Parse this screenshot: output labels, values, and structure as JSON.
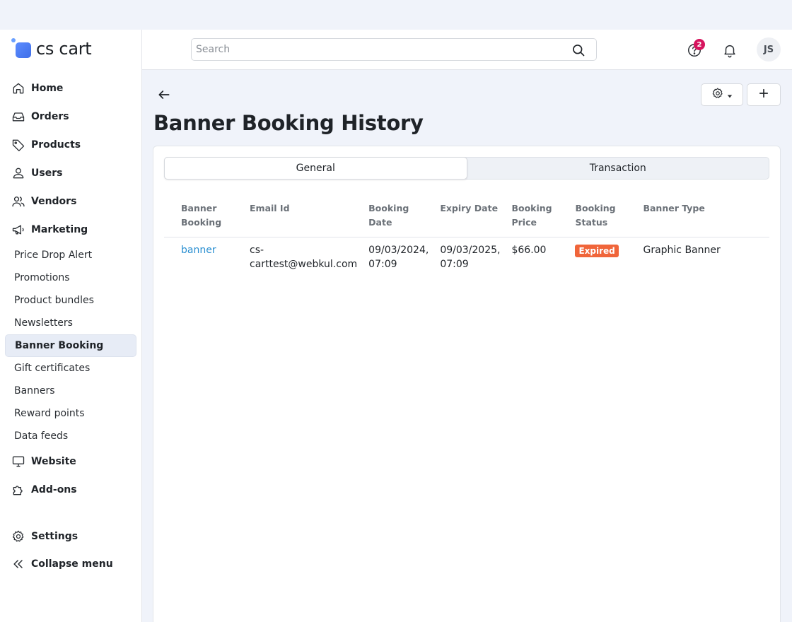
{
  "app": {
    "logo_text": "cs cart"
  },
  "header": {
    "search_placeholder": "Search",
    "help_badge_count": "2",
    "avatar_initials": "JS"
  },
  "sidebar": {
    "main": [
      {
        "label": "Home",
        "icon": "home-icon"
      },
      {
        "label": "Orders",
        "icon": "inbox-icon"
      },
      {
        "label": "Products",
        "icon": "tag-icon"
      },
      {
        "label": "Users",
        "icon": "user-icon"
      },
      {
        "label": "Vendors",
        "icon": "users-icon"
      },
      {
        "label": "Marketing",
        "icon": "megaphone-icon"
      }
    ],
    "marketing_sub": [
      {
        "label": "Price Drop Alert"
      },
      {
        "label": "Promotions"
      },
      {
        "label": "Product bundles"
      },
      {
        "label": "Newsletters"
      },
      {
        "label": "Banner Booking",
        "active": true
      },
      {
        "label": "Gift certificates"
      },
      {
        "label": "Banners"
      },
      {
        "label": "Reward points"
      },
      {
        "label": "Data feeds"
      }
    ],
    "after": [
      {
        "label": "Website",
        "icon": "monitor-icon"
      },
      {
        "label": "Add-ons",
        "icon": "puzzle-icon"
      }
    ],
    "bottom": [
      {
        "label": "Settings",
        "icon": "gear-icon"
      },
      {
        "label": "Collapse menu",
        "icon": "double-chevron-left-icon"
      }
    ]
  },
  "page": {
    "title": "Banner Booking History",
    "tabs": [
      {
        "label": "General",
        "active": true
      },
      {
        "label": "Transaction",
        "active": false
      }
    ],
    "table": {
      "headers": [
        [
          "Banner Booking"
        ],
        [
          "Email Id"
        ],
        [
          "Booking Date"
        ],
        [
          "Expiry Date"
        ],
        [
          "Booking",
          "Price"
        ],
        [
          "Booking",
          "Status"
        ],
        [
          "Banner Type"
        ]
      ],
      "rows": [
        {
          "banner_booking": "banner",
          "email_line1": "cs-",
          "email_line2": "carttest@webkul.com",
          "booking_date_line1": "09/03/2024,",
          "booking_date_line2": "07:09",
          "expiry_date_line1": "09/03/2025,",
          "expiry_date_line2": "07:09",
          "price": "$66.00",
          "status": "Expired",
          "banner_type": "Graphic Banner"
        }
      ]
    }
  },
  "colors": {
    "accent_link": "#2a8fd1",
    "status_expired": "#f0653a",
    "badge": "#d6155e"
  }
}
